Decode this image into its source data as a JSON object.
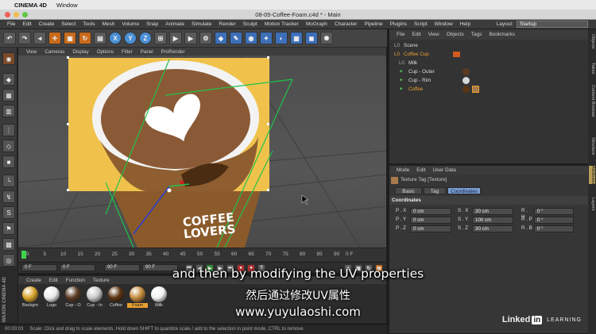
{
  "macbar": {
    "apple": "",
    "app": "CINEMA 4D",
    "window": "Window"
  },
  "titlebar": {
    "title": "08-05-Coffee-Foam.c4d * - Main"
  },
  "appmenu": [
    "File",
    "Edit",
    "Create",
    "Select",
    "Tools",
    "Mesh",
    "Volume",
    "Snap",
    "Animate",
    "Simulate",
    "Render",
    "Sculpt",
    "Motion Tracker",
    "MoGraph",
    "Character",
    "Pipeline",
    "Plugins",
    "Script",
    "Window",
    "Help"
  ],
  "layout": {
    "label": "Layout:",
    "value": "Startup"
  },
  "toolbar": {
    "undo": "↶",
    "redo": "↷",
    "x": "X",
    "y": "Y",
    "z": "Z"
  },
  "viewport": {
    "menu": [
      "View",
      "Cameras",
      "Display",
      "Options",
      "Filter",
      "Panel",
      "ProRender"
    ],
    "cup_text_line1": "COFFEE",
    "cup_text_line2": "LOVERS",
    "texture_bg": "#f0c24c",
    "foam_color": "#8a5a36"
  },
  "timeline": {
    "ticks": [
      "0",
      "5",
      "10",
      "15",
      "20",
      "25",
      "30",
      "35",
      "40",
      "45",
      "50",
      "55",
      "60",
      "65",
      "70",
      "75",
      "80",
      "85",
      "90"
    ],
    "frame_end": "0 F",
    "start_field": "0 F",
    "min_field": "0 F",
    "max_field": "90 F",
    "end_field": "90 F"
  },
  "materials": {
    "menu": [
      "Create",
      "Edit",
      "Function",
      "Texture"
    ],
    "items": [
      {
        "name": "Backgro",
        "color": "#d8a32a"
      },
      {
        "name": "Logo",
        "color": "#ececec"
      },
      {
        "name": "Cup - O",
        "color": "#5a3a22"
      },
      {
        "name": "Cup - In",
        "color": "#c9c9c9"
      },
      {
        "name": "Coffee",
        "color": "#5b3412"
      },
      {
        "name": "Foam",
        "color": "#c48a3c"
      },
      {
        "name": "Milk",
        "color": "#f2f2f2"
      }
    ]
  },
  "status": {
    "time": "00:00:03",
    "message": "Scale: Click and drag to scale elements. Hold down SHIFT to quantize scale / add to the selection in point mode, CTRL to remove."
  },
  "objects": {
    "menu": [
      "File",
      "Edit",
      "View",
      "Objects",
      "Tags",
      "Bookmarks"
    ],
    "rows": [
      {
        "name": "Scene",
        "indent": 0
      },
      {
        "name": "Coffee Cup",
        "indent": 0
      },
      {
        "name": "Milk",
        "indent": 1
      },
      {
        "name": "Cup - Outer",
        "indent": 1
      },
      {
        "name": "Cup - Rim",
        "indent": 1
      },
      {
        "name": "Coffee",
        "indent": 1
      }
    ]
  },
  "attributes": {
    "menu": [
      "Mode",
      "Edit",
      "User Data"
    ],
    "title": "Texture Tag [Texture]",
    "tabs": [
      "Basic",
      "Tag",
      "Coordinates"
    ],
    "active_tab": "Coordinates",
    "section": "Coordinates",
    "rows": [
      {
        "p_label": "P . X",
        "p_val": "0 cm",
        "s_label": "S . X",
        "s_val": "30 cm",
        "r_label": "R . H",
        "r_val": "0 °"
      },
      {
        "p_label": "P . Y",
        "p_val": "0 cm",
        "s_label": "S . Y",
        "s_val": "100 cm",
        "r_label": "R . P",
        "r_val": "0 °"
      },
      {
        "p_label": "P . Z",
        "p_val": "0 cm",
        "s_label": "S . Z",
        "s_val": "30 cm",
        "r_label": "R . B",
        "r_val": "0 °"
      }
    ]
  },
  "right_tabs": [
    "Objects",
    "Takes",
    "Content Browser",
    "Structure",
    "Attributes",
    "Layers"
  ],
  "maxon": "MAXON CINEMA 4D",
  "subtitles": {
    "english": "and then by modifying the UV properties",
    "chinese": "然后通过修改UV属性",
    "url": "www.yuyulaoshi.com"
  },
  "brand": {
    "linked": "Linked",
    "in": "in",
    "learning": "LEARNING"
  }
}
